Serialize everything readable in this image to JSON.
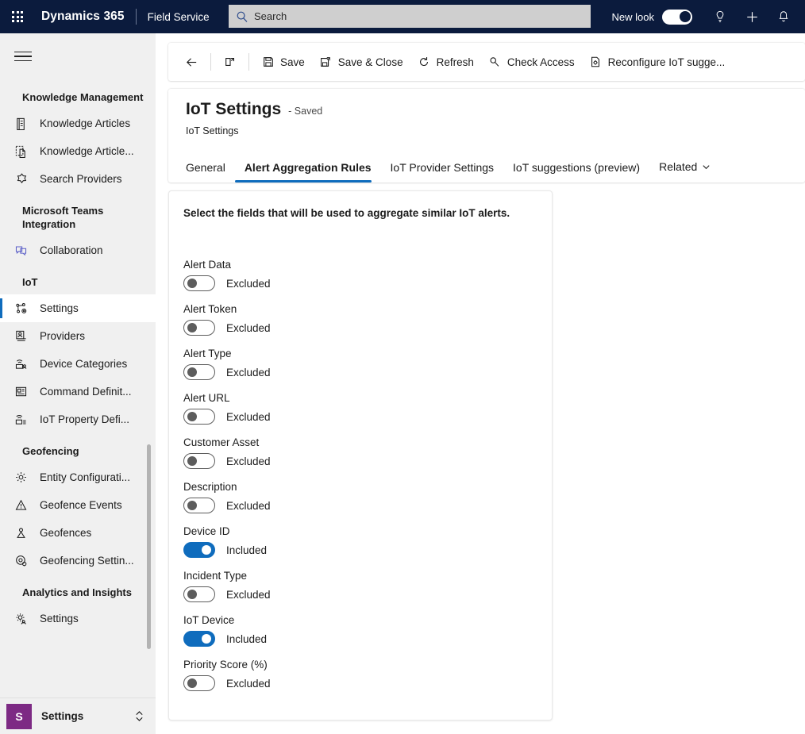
{
  "header": {
    "waffle_name": "app-launcher-icon",
    "brand": "Dynamics 365",
    "app_name": "Field Service",
    "search_placeholder": "Search",
    "new_look_label": "New look",
    "new_look_on": true,
    "icons": [
      "lightbulb-icon",
      "plus-icon",
      "bell-icon"
    ],
    "background_color": "#0b1b3d"
  },
  "sidebar": {
    "groups": [
      {
        "title": "Knowledge Management",
        "items": [
          {
            "label": "Knowledge Articles",
            "icon": "knowledge-article-icon",
            "selected": false
          },
          {
            "label": "Knowledge Article...",
            "icon": "knowledge-article-template-icon",
            "selected": false
          },
          {
            "label": "Search Providers",
            "icon": "search-providers-icon",
            "selected": false
          }
        ]
      },
      {
        "title": "Microsoft Teams Integration",
        "items": [
          {
            "label": "Collaboration",
            "icon": "collaboration-icon",
            "selected": false
          }
        ]
      },
      {
        "title": "IoT",
        "items": [
          {
            "label": "Settings",
            "icon": "iot-settings-icon",
            "selected": true
          },
          {
            "label": "Providers",
            "icon": "providers-icon",
            "selected": false
          },
          {
            "label": "Device Categories",
            "icon": "device-categories-icon",
            "selected": false
          },
          {
            "label": "Command Definit...",
            "icon": "command-definitions-icon",
            "selected": false
          },
          {
            "label": "IoT Property Defi...",
            "icon": "iot-property-definitions-icon",
            "selected": false
          }
        ]
      },
      {
        "title": "Geofencing",
        "items": [
          {
            "label": "Entity Configurati...",
            "icon": "gear-icon",
            "selected": false
          },
          {
            "label": "Geofence Events",
            "icon": "warning-triangle-icon",
            "selected": false
          },
          {
            "label": "Geofences",
            "icon": "geofence-icon",
            "selected": false
          },
          {
            "label": "Geofencing Settin...",
            "icon": "geofencing-settings-icon",
            "selected": false
          }
        ]
      },
      {
        "title": "Analytics and Insights",
        "items": [
          {
            "label": "Settings",
            "icon": "analytics-settings-icon",
            "selected": false
          }
        ]
      }
    ],
    "footer": {
      "badge": "S",
      "badge_color": "#7d2a84",
      "label": "Settings"
    }
  },
  "commandbar": {
    "back_icon": "back-arrow-icon",
    "popout_icon": "open-in-new-window-icon",
    "buttons": [
      {
        "label": "Save",
        "icon": "save-icon"
      },
      {
        "label": "Save & Close",
        "icon": "save-and-close-icon"
      },
      {
        "label": "Refresh",
        "icon": "refresh-icon"
      },
      {
        "label": "Check Access",
        "icon": "check-access-icon"
      },
      {
        "label": "Reconfigure IoT sugge...",
        "icon": "reconfigure-icon"
      }
    ]
  },
  "record": {
    "title": "IoT Settings",
    "status": "- Saved",
    "subtitle": "IoT Settings",
    "tabs": [
      {
        "label": "General",
        "active": false
      },
      {
        "label": "Alert Aggregation Rules",
        "active": true
      },
      {
        "label": "IoT Provider Settings",
        "active": false
      },
      {
        "label": "IoT suggestions (preview)",
        "active": false
      },
      {
        "label": "Related",
        "active": false,
        "has_caret": true
      }
    ]
  },
  "form": {
    "heading": "Select the fields that will be used to aggregate similar IoT alerts.",
    "accent_color": "#0f6cbd",
    "fields": [
      {
        "label": "Alert Data",
        "state": "Excluded",
        "on": false
      },
      {
        "label": "Alert Token",
        "state": "Excluded",
        "on": false
      },
      {
        "label": "Alert Type",
        "state": "Excluded",
        "on": false
      },
      {
        "label": "Alert URL",
        "state": "Excluded",
        "on": false
      },
      {
        "label": "Customer Asset",
        "state": "Excluded",
        "on": false
      },
      {
        "label": "Description",
        "state": "Excluded",
        "on": false
      },
      {
        "label": "Device ID",
        "state": "Included",
        "on": true
      },
      {
        "label": "Incident Type",
        "state": "Excluded",
        "on": false
      },
      {
        "label": "IoT Device",
        "state": "Included",
        "on": true
      },
      {
        "label": "Priority Score (%)",
        "state": "Excluded",
        "on": false
      }
    ]
  }
}
